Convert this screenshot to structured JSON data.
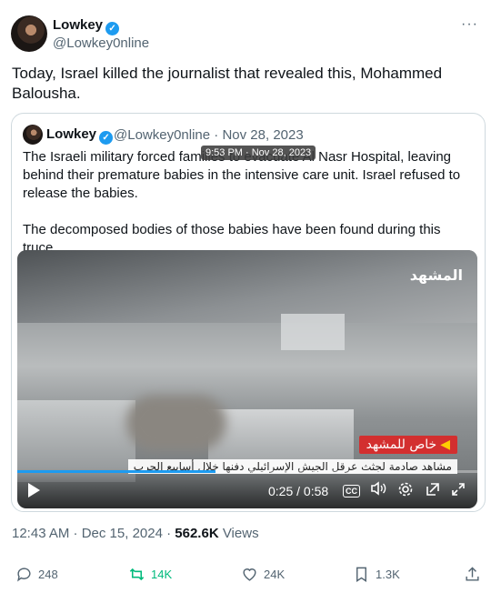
{
  "author": {
    "name": "Lowkey",
    "handle": "@Lowkey0nline"
  },
  "more_label": "···",
  "tweet": {
    "text": "Today, Israel killed the journalist that revealed this, Mohammed Balousha."
  },
  "quote": {
    "name": "Lowkey",
    "handle_date": "@Lowkey0nline · Nov 28, 2023",
    "tooltip": "9:53 PM · Nov 28, 2023",
    "text1": "The Israeli military forced families to evacuate Al Nasr Hospital, leaving behind their premature babies in the intensive care unit. Israel refused to release the babies.",
    "text2": "The decomposed bodies of those babies have been found during this truce.",
    "video": {
      "logo": "المشهد",
      "tag": "خاص للمشهد",
      "caption": "مشاهد صادمة لجثث عرقل الجيش الإسرائيلي دفنها خلال أسابيع الحرب",
      "time": "0:25 / 0:58",
      "progress": 0.43,
      "cc_label": "CC"
    }
  },
  "meta": {
    "time": "12:43 AM · Dec 15, 2024 · ",
    "views_count": "562.6K",
    "views_label": " Views"
  },
  "actions": {
    "replies": "248",
    "reposts": "14K",
    "likes": "24K",
    "bookmarks": "1.3K"
  },
  "colors": {
    "accent": "#1d9bf0",
    "repost_active": "#00ba7c",
    "muted": "#536471",
    "tag_red": "#d32f2f"
  }
}
